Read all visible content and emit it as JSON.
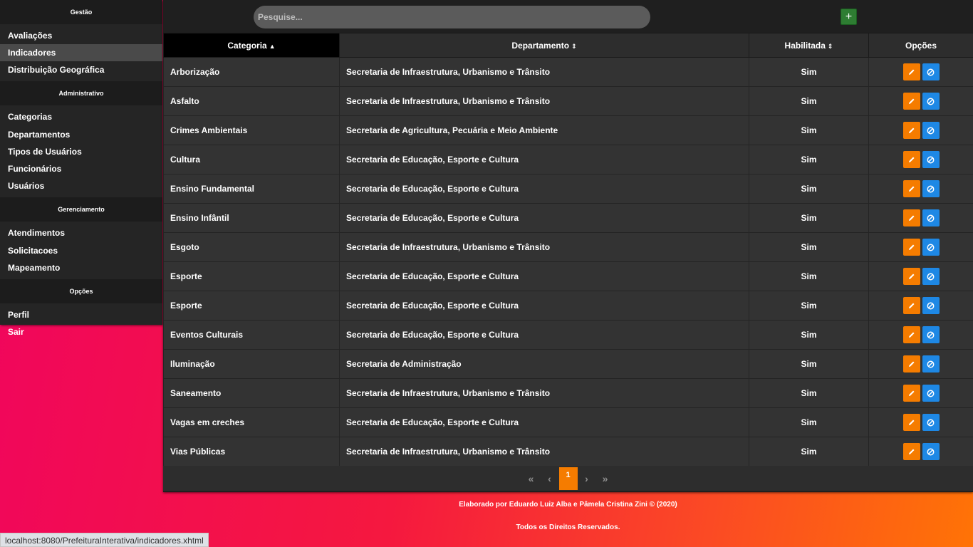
{
  "sidebar": {
    "sections": [
      {
        "title": "Gestão",
        "items": [
          {
            "label": "Avaliações",
            "active": false
          },
          {
            "label": "Indicadores",
            "active": true
          },
          {
            "label": "Distribuição Geográfica",
            "active": false
          }
        ]
      },
      {
        "title": "Administrativo",
        "items": [
          {
            "label": "Categorias",
            "active": false
          },
          {
            "label": "Departamentos",
            "active": false
          },
          {
            "label": "Tipos de Usuários",
            "active": false
          },
          {
            "label": "Funcionários",
            "active": false
          },
          {
            "label": "Usuários",
            "active": false
          }
        ]
      },
      {
        "title": "Gerenciamento",
        "items": [
          {
            "label": "Atendimentos",
            "active": false
          },
          {
            "label": "Solicitacoes",
            "active": false
          },
          {
            "label": "Mapeamento",
            "active": false
          }
        ]
      },
      {
        "title": "Opções",
        "items": [
          {
            "label": "Perfil",
            "active": false
          },
          {
            "label": "Sair",
            "active": false
          }
        ]
      }
    ]
  },
  "search": {
    "placeholder": "Pesquise..."
  },
  "toolbar": {
    "add_label": "+",
    "add_color": "#2e7d32"
  },
  "table": {
    "columns": [
      {
        "label": "Categoria",
        "sort": "asc"
      },
      {
        "label": "Departamento",
        "sort": "both"
      },
      {
        "label": "Habilitada",
        "sort": "both"
      },
      {
        "label": "Opções",
        "sort": null
      }
    ],
    "rows": [
      {
        "categoria": "Arborização",
        "departamento": "Secretaria de Infraestrutura, Urbanismo e Trânsito",
        "habilitada": "Sim"
      },
      {
        "categoria": "Asfalto",
        "departamento": "Secretaria de Infraestrutura, Urbanismo e Trânsito",
        "habilitada": "Sim"
      },
      {
        "categoria": "Crimes Ambientais",
        "departamento": "Secretaria de Agricultura, Pecuária e Meio Ambiente",
        "habilitada": "Sim"
      },
      {
        "categoria": "Cultura",
        "departamento": "Secretaria de Educação, Esporte e Cultura",
        "habilitada": "Sim"
      },
      {
        "categoria": "Ensino Fundamental",
        "departamento": "Secretaria de Educação, Esporte e Cultura",
        "habilitada": "Sim"
      },
      {
        "categoria": "Ensino Infântil",
        "departamento": "Secretaria de Educação, Esporte e Cultura",
        "habilitada": "Sim"
      },
      {
        "categoria": "Esgoto",
        "departamento": "Secretaria de Infraestrutura, Urbanismo e Trânsito",
        "habilitada": "Sim"
      },
      {
        "categoria": "Esporte",
        "departamento": "Secretaria de Educação, Esporte e Cultura",
        "habilitada": "Sim"
      },
      {
        "categoria": "Esporte",
        "departamento": "Secretaria de Educação, Esporte e Cultura",
        "habilitada": "Sim"
      },
      {
        "categoria": "Eventos Culturais",
        "departamento": "Secretaria de Educação, Esporte e Cultura",
        "habilitada": "Sim"
      },
      {
        "categoria": "Iluminação",
        "departamento": "Secretaria de Administração",
        "habilitada": "Sim"
      },
      {
        "categoria": "Saneamento",
        "departamento": "Secretaria de Infraestrutura, Urbanismo e Trânsito",
        "habilitada": "Sim"
      },
      {
        "categoria": "Vagas em creches",
        "departamento": "Secretaria de Educação, Esporte e Cultura",
        "habilitada": "Sim"
      },
      {
        "categoria": "Vias Públicas",
        "departamento": "Secretaria de Infraestrutura, Urbanismo e Trânsito",
        "habilitada": "Sim"
      }
    ],
    "row_actions": {
      "edit_icon": "pencil-icon",
      "edit_color": "#f57c00",
      "block_icon": "ban-icon",
      "block_color": "#1e88e5"
    }
  },
  "paginator": {
    "first": "«",
    "prev": "‹",
    "current_page": "1",
    "next": "›",
    "last": "»"
  },
  "footer": {
    "credits": "Elaborado por Eduardo Luiz Alba e Pâmela Cristina Zini © (2020)",
    "rights": "Todos os Direitos Reservados."
  },
  "status_bar": {
    "url": "localhost:8080/PrefeituraInterativa/indicadores.xhtml"
  }
}
